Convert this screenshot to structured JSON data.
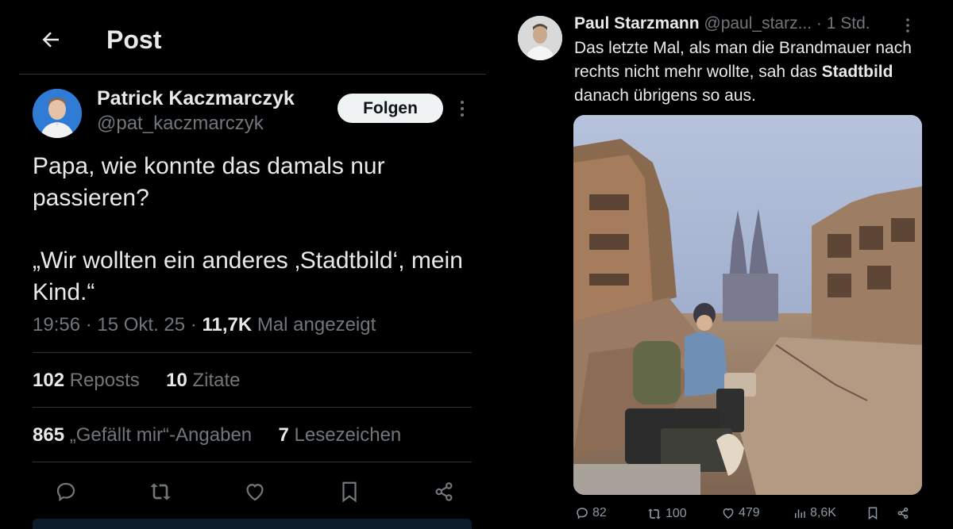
{
  "header": {
    "title": "Post"
  },
  "post": {
    "author_name": "Patrick Kaczmarczyk",
    "author_handle": "@pat_kaczmarczyk",
    "follow_label": "Folgen",
    "text_line1": "Papa, wie konnte das damals nur passieren?",
    "text_line2": "„Wir wollten ein anderes ‚Stadtbild‘, mein Kind.“",
    "time": "19:56 · 15 Okt. 25 · ",
    "views_count": "11,7K",
    "views_label": " Mal angezeigt",
    "reposts_count": "102",
    "reposts_label": " Reposts",
    "quotes_count": "10",
    "quotes_label": " Zitate",
    "likes_count": "865",
    "likes_label": " „Gefällt mir“-Angaben",
    "bookmarks_count": "7",
    "bookmarks_label": " Lesezeichen"
  },
  "embedded": {
    "author_name": "Paul Starzmann",
    "author_handle": " @paul_starz...",
    "time": " · 1 Std.",
    "text_before": "Das letzte Mal, als man die Brandmauer nach rechts nicht mehr wollte, sah das ",
    "text_bold": "Stadtbild",
    "text_after": " danach übrigens so aus.",
    "replies": "82",
    "reposts": "100",
    "likes": "479",
    "views": "8,6K"
  },
  "colors": {
    "background": "#000000",
    "text": "#e7e9ea",
    "muted": "#71767b",
    "follow_bg": "#eff3f4"
  },
  "icons": [
    "back-arrow-icon",
    "more-icon",
    "reply-icon",
    "repost-icon",
    "like-icon",
    "bookmark-icon",
    "share-icon",
    "views-icon"
  ]
}
